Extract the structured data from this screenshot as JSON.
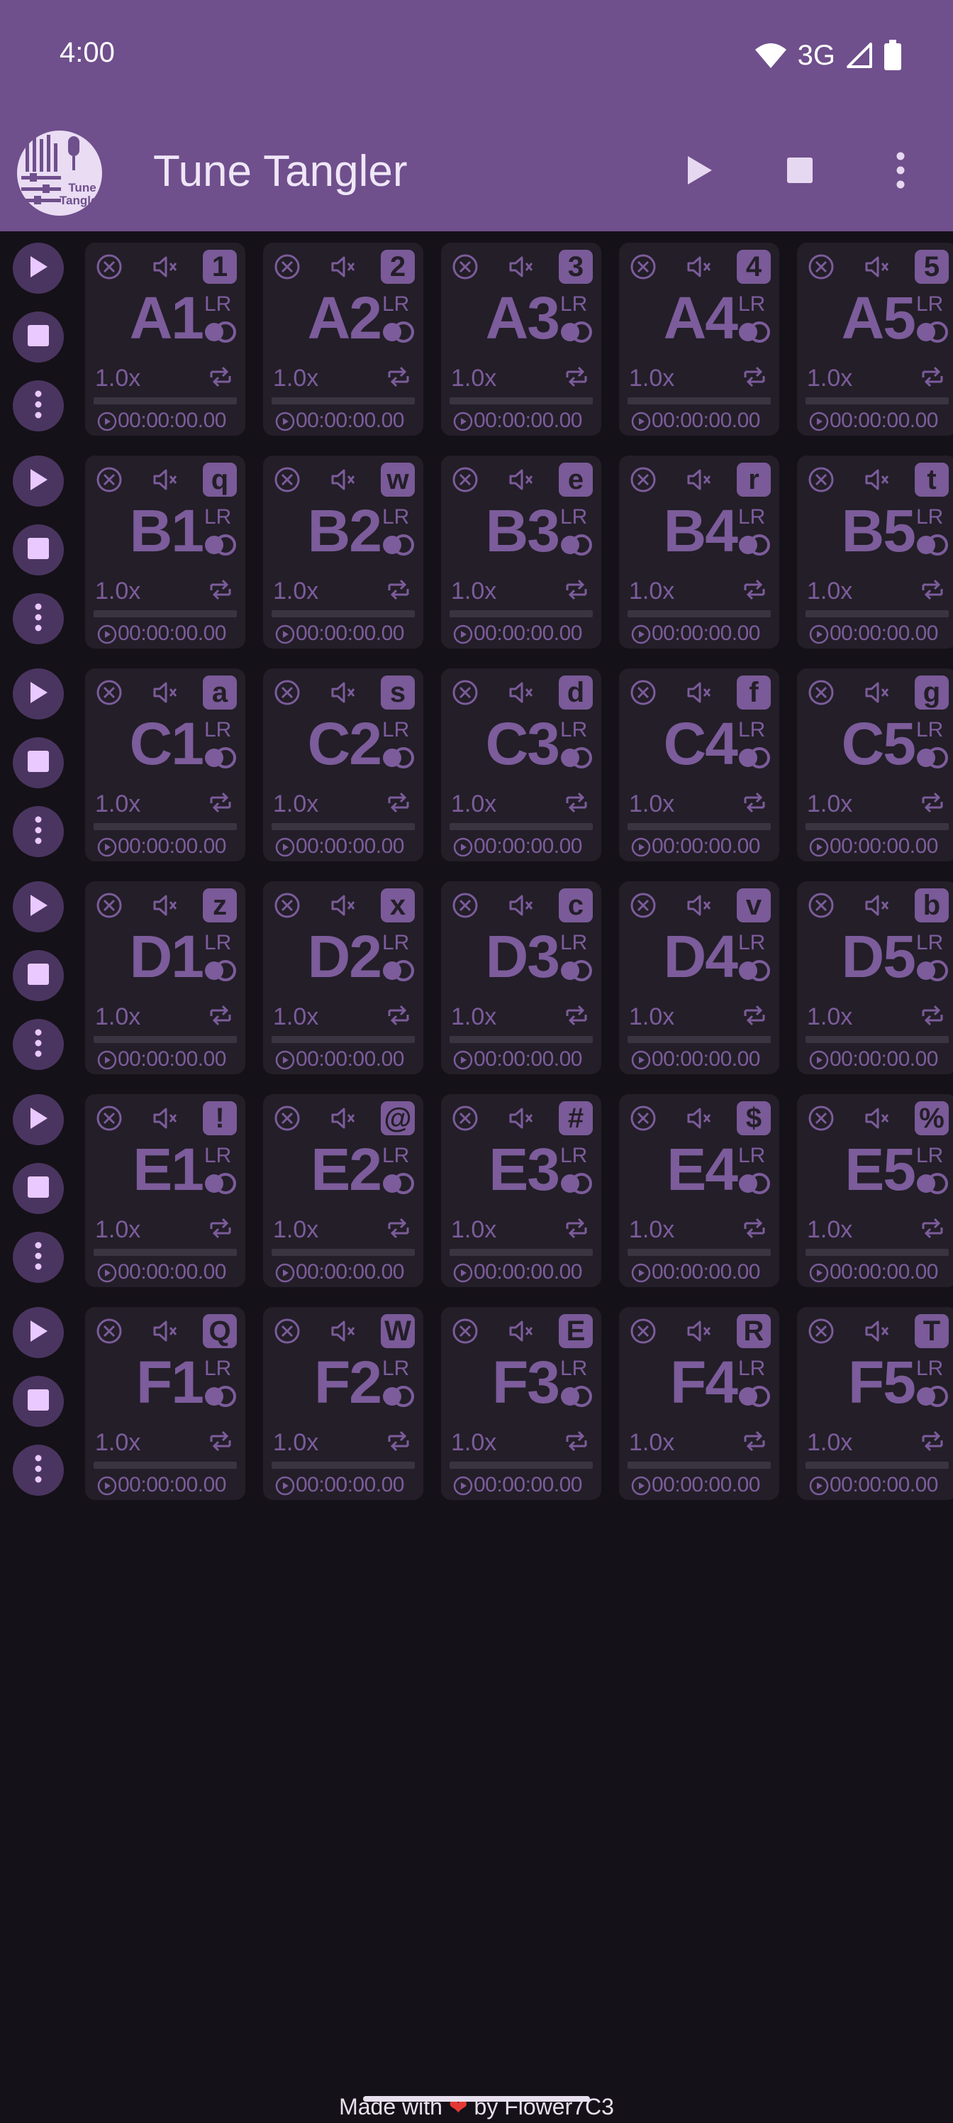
{
  "status_bar": {
    "time": "4:00",
    "network": "3G",
    "icons": [
      "wifi-icon",
      "cell-signal-icon",
      "battery-icon"
    ]
  },
  "app_bar": {
    "title": "Tune Tangler",
    "logo_text": [
      "Tune",
      "Tangler"
    ],
    "actions": [
      "play-icon",
      "stop-icon",
      "more-vert-icon"
    ]
  },
  "pad_defaults": {
    "lr": "LR",
    "speed": "1.0x",
    "time": "00:00:00.00"
  },
  "rows": [
    {
      "pads": [
        {
          "label": "A1",
          "key": "1"
        },
        {
          "label": "A2",
          "key": "2"
        },
        {
          "label": "A3",
          "key": "3"
        },
        {
          "label": "A4",
          "key": "4"
        },
        {
          "label": "A5",
          "key": "5"
        }
      ]
    },
    {
      "pads": [
        {
          "label": "B1",
          "key": "q"
        },
        {
          "label": "B2",
          "key": "w"
        },
        {
          "label": "B3",
          "key": "e"
        },
        {
          "label": "B4",
          "key": "r"
        },
        {
          "label": "B5",
          "key": "t"
        }
      ]
    },
    {
      "pads": [
        {
          "label": "C1",
          "key": "a"
        },
        {
          "label": "C2",
          "key": "s"
        },
        {
          "label": "C3",
          "key": "d"
        },
        {
          "label": "C4",
          "key": "f"
        },
        {
          "label": "C5",
          "key": "g"
        }
      ]
    },
    {
      "pads": [
        {
          "label": "D1",
          "key": "z"
        },
        {
          "label": "D2",
          "key": "x"
        },
        {
          "label": "D3",
          "key": "c"
        },
        {
          "label": "D4",
          "key": "v"
        },
        {
          "label": "D5",
          "key": "b"
        }
      ]
    },
    {
      "pads": [
        {
          "label": "E1",
          "key": "!"
        },
        {
          "label": "E2",
          "key": "@"
        },
        {
          "label": "E3",
          "key": "#"
        },
        {
          "label": "E4",
          "key": "$"
        },
        {
          "label": "E5",
          "key": "%"
        }
      ]
    },
    {
      "pads": [
        {
          "label": "F1",
          "key": "Q"
        },
        {
          "label": "F2",
          "key": "W"
        },
        {
          "label": "F3",
          "key": "E"
        },
        {
          "label": "F4",
          "key": "R"
        },
        {
          "label": "F5",
          "key": "T"
        }
      ]
    }
  ],
  "footer": {
    "prefix": "Made with",
    "suffix": "by Flower7C3",
    "heart": "❤"
  },
  "colors": {
    "primary": "#6f4f8c",
    "background": "#151118",
    "pad": "#231e28",
    "pad_accent": "#7c5c9b",
    "round_button": "#4a3560",
    "round_icon": "#e9c9ff"
  }
}
